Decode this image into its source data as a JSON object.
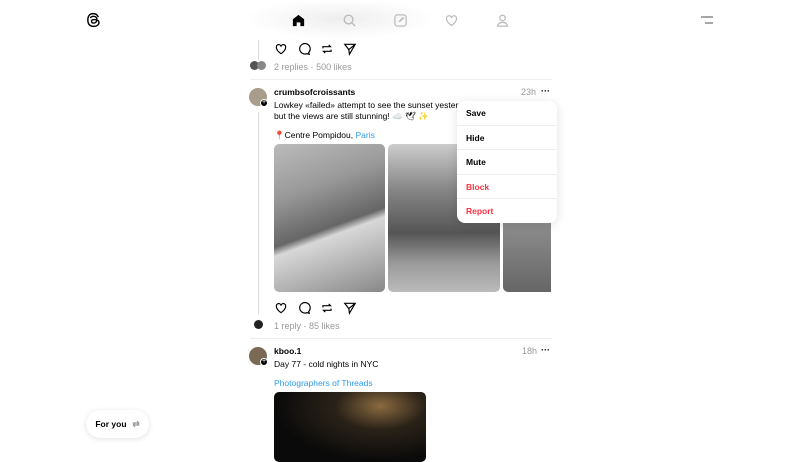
{
  "nav": {
    "icons": [
      "threads-logo",
      "home-icon",
      "search-icon",
      "compose-icon",
      "heart-icon",
      "profile-icon",
      "menu-icon"
    ]
  },
  "post0": {
    "stats_replies": "2 replies",
    "stats_dot": "·",
    "stats_likes": "500 likes"
  },
  "post1": {
    "username": "crumbsofcroissants",
    "time": "23h",
    "more": "···",
    "text1": "Lowkey «failed» attempt to see the sunset yesterd",
    "text2": "but the views are still stunning! ☁️ 🕊 ✨",
    "location_pin": "📍",
    "location": "Centre Pompidou, ",
    "location_link": "Paris",
    "stats_replies": "1 reply",
    "stats_dot": "·",
    "stats_likes": "85 likes"
  },
  "menu": {
    "items": [
      "Save",
      "Hide",
      "Mute",
      "Block",
      "Report"
    ],
    "danger_color": "#ff3040"
  },
  "post2": {
    "username": "kboo.1",
    "time": "18h",
    "more": "···",
    "text": "Day 77 - cold nights in NYC",
    "tag": "Photographers of Threads"
  },
  "feed_toggle": {
    "label": "For you",
    "icon": "⇄"
  },
  "colors": {
    "link": "#2d9cf0"
  }
}
